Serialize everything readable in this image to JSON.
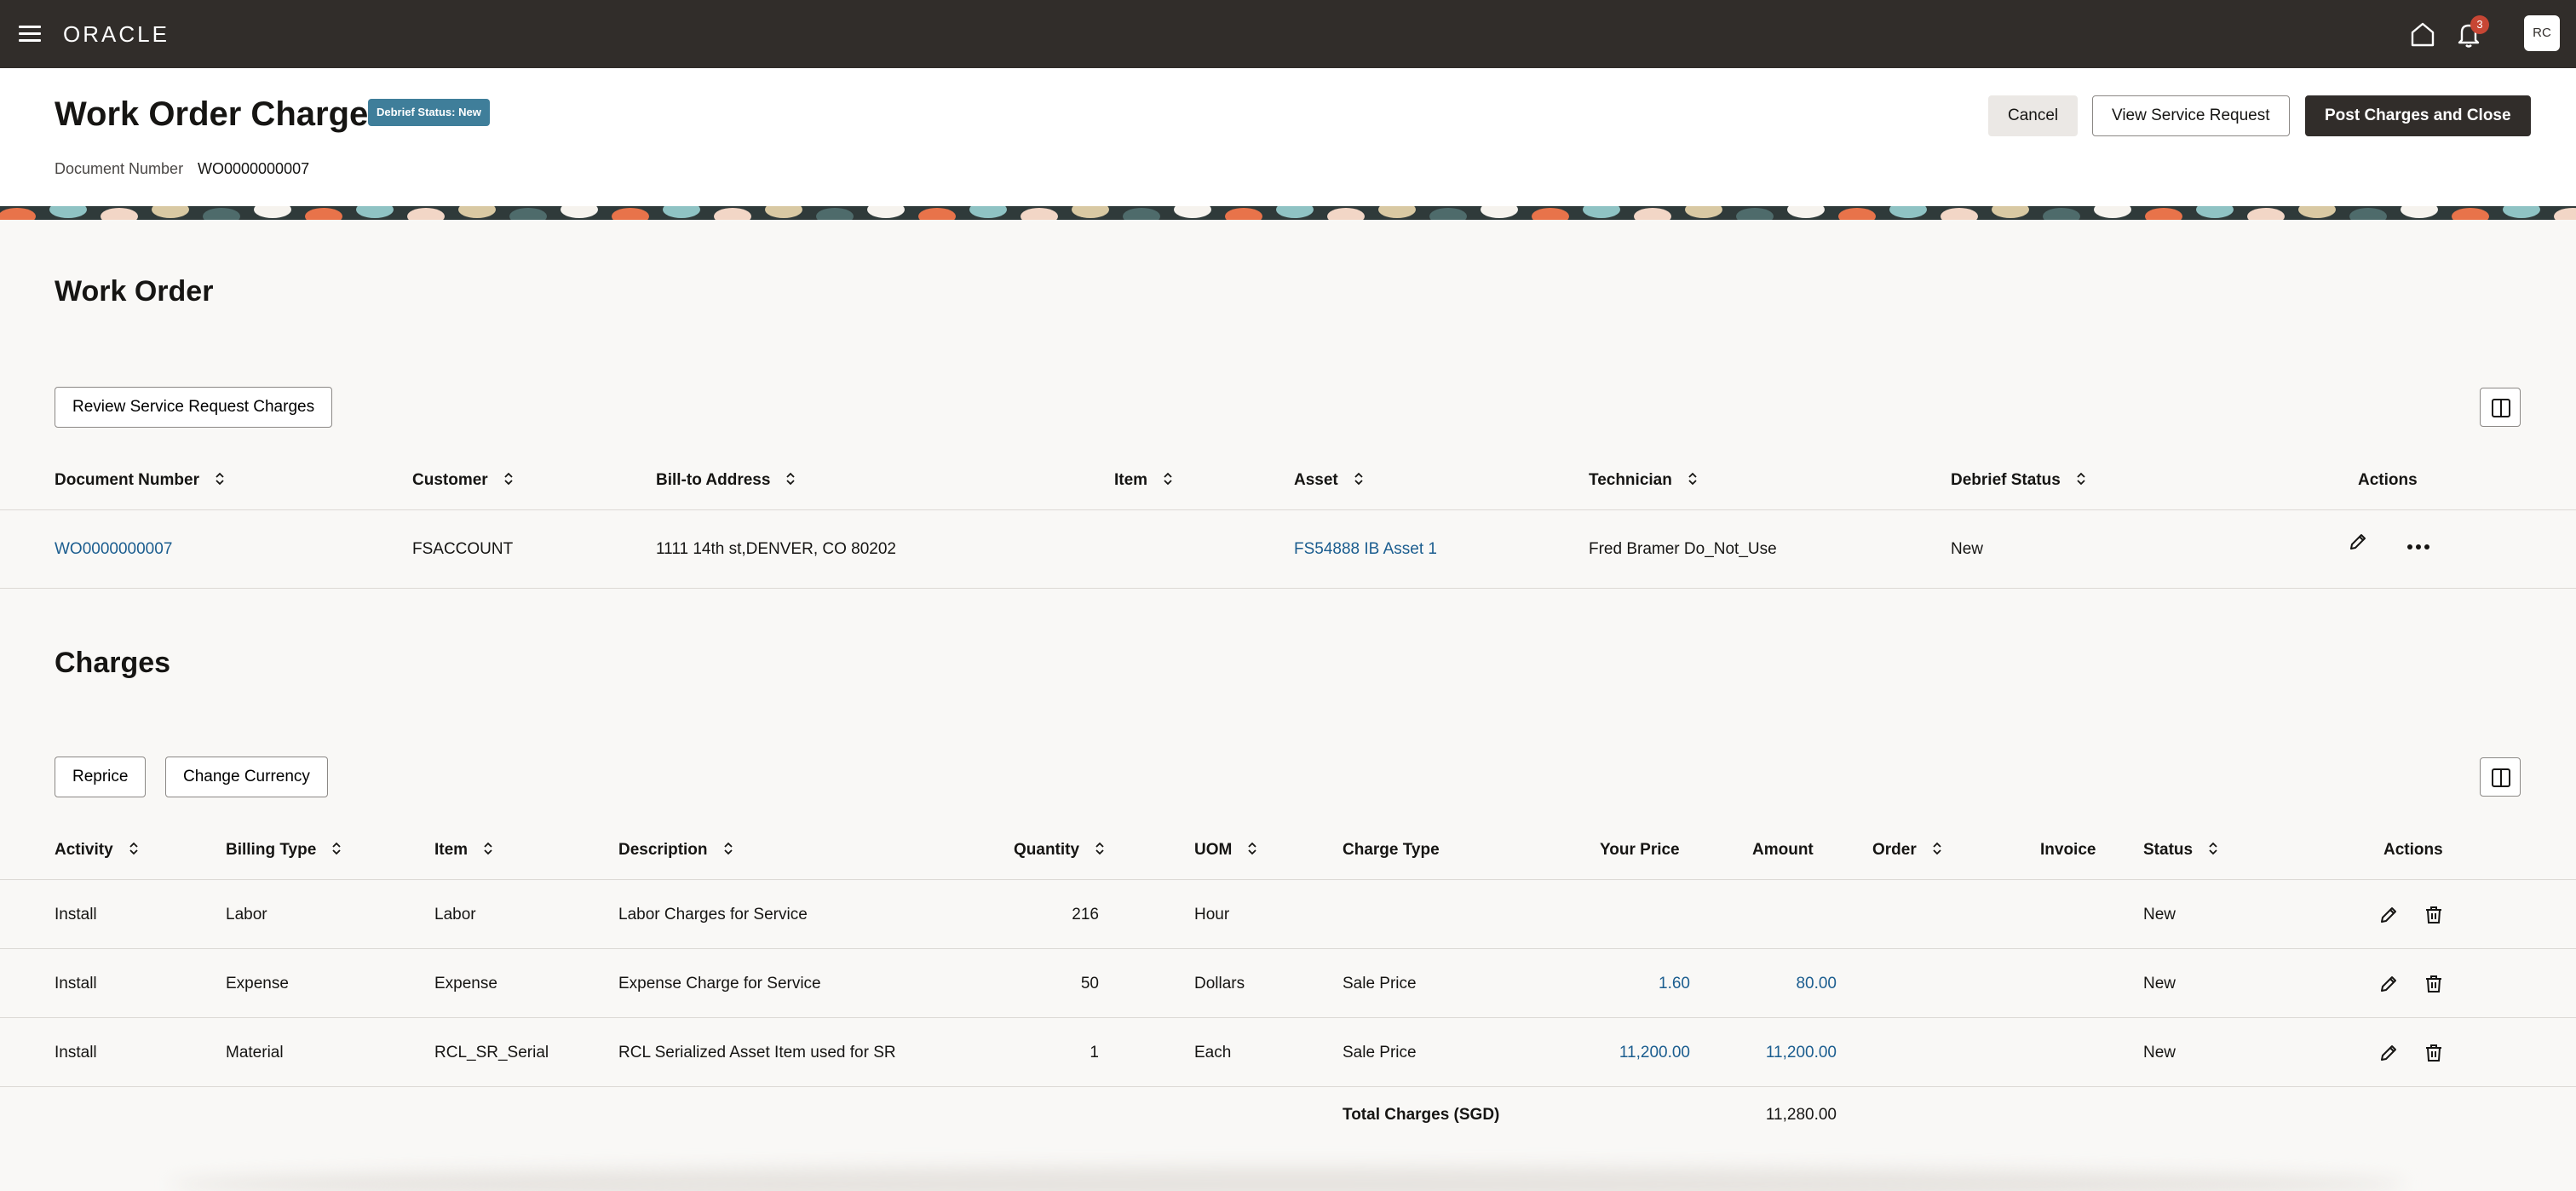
{
  "topbar": {
    "logo": "ORACLE",
    "notification_count": "3",
    "avatar_initials": "RC"
  },
  "header": {
    "title": "Work Order Charges",
    "status_badge": "Debrief Status: New",
    "doc_label": "Document Number",
    "doc_value": "WO0000000007",
    "buttons": {
      "cancel": "Cancel",
      "view_sr": "View Service Request",
      "post": "Post Charges and Close"
    }
  },
  "work_order": {
    "title": "Work Order",
    "review_button": "Review Service Request Charges",
    "columns": [
      "Document Number",
      "Customer",
      "Bill-to Address",
      "Item",
      "Asset",
      "Technician",
      "Debrief Status",
      "Actions"
    ],
    "row": {
      "document_number": "WO0000000007",
      "customer": "FSACCOUNT",
      "bill_to": "1111 14th st,DENVER, CO 80202",
      "item": "",
      "asset": "FS54888 IB Asset 1",
      "technician": "Fred Bramer Do_Not_Use",
      "debrief_status": "New"
    }
  },
  "charges": {
    "title": "Charges",
    "reprice_button": "Reprice",
    "currency_button": "Change Currency",
    "columns": [
      "Activity",
      "Billing Type",
      "Item",
      "Description",
      "Quantity",
      "UOM",
      "Charge Type",
      "Your Price",
      "Amount",
      "Order",
      "Invoice",
      "Status",
      "Actions"
    ],
    "rows": [
      {
        "activity": "Install",
        "billing_type": "Labor",
        "item": "Labor",
        "description": "Labor Charges for Service",
        "quantity": "216",
        "uom": "Hour",
        "charge_type": "",
        "your_price": "",
        "amount": "",
        "order": "",
        "invoice": "",
        "status": "New"
      },
      {
        "activity": "Install",
        "billing_type": "Expense",
        "item": "Expense",
        "description": "Expense Charge for Service",
        "quantity": "50",
        "uom": "Dollars",
        "charge_type": "Sale Price",
        "your_price": "1.60",
        "amount": "80.00",
        "order": "",
        "invoice": "",
        "status": "New"
      },
      {
        "activity": "Install",
        "billing_type": "Material",
        "item": "RCL_SR_Serial",
        "description": "RCL Serialized Asset Item used for SR",
        "quantity": "1",
        "uom": "Each",
        "charge_type": "Sale Price",
        "your_price": "11,200.00",
        "amount": "11,200.00",
        "order": "",
        "invoice": "",
        "status": "New"
      }
    ],
    "total_label": "Total Charges (SGD)",
    "total_value": "11,280.00"
  },
  "colors": {
    "topbar": "#312d2a",
    "link": "#1b5d8f",
    "badge": "#3f7e9a",
    "notification": "#c74634"
  }
}
